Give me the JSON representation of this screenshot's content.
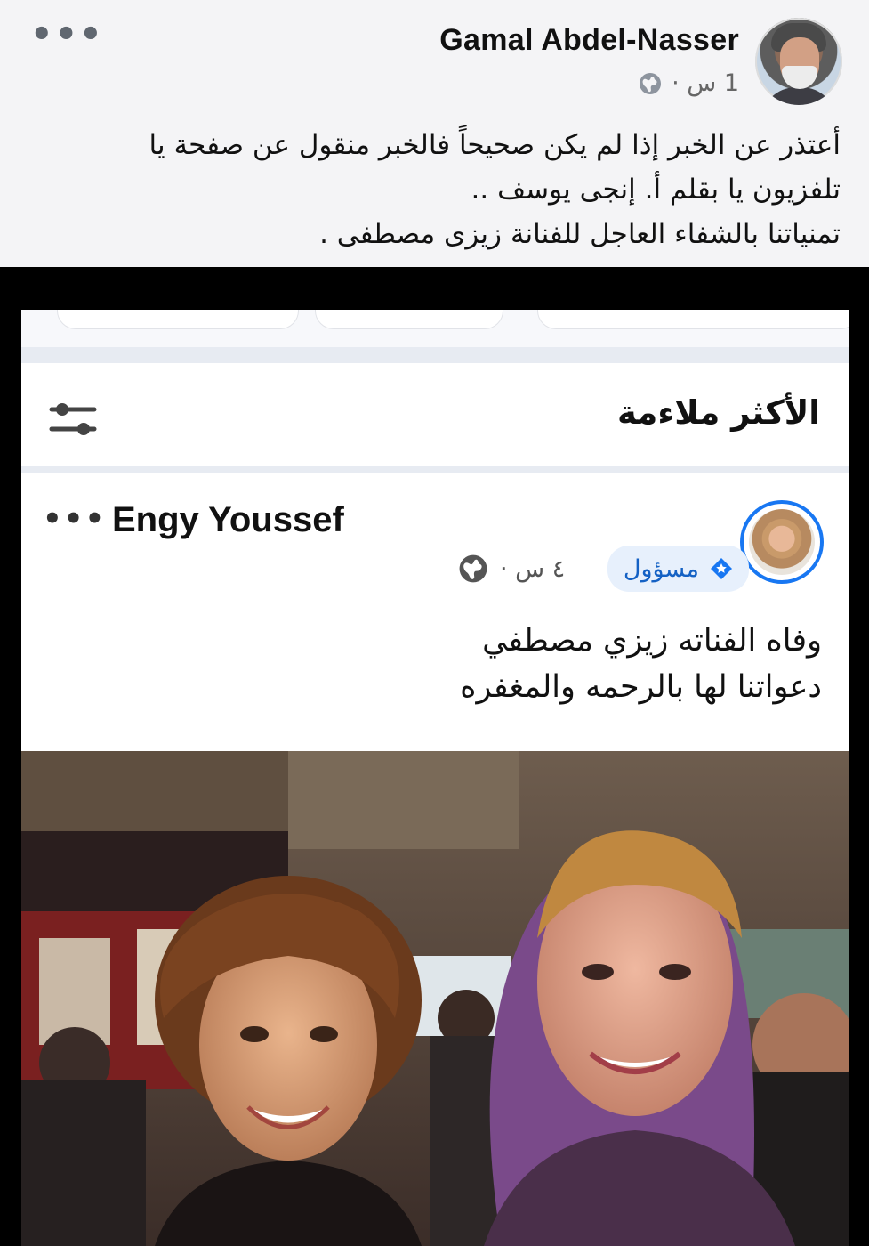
{
  "outer_post": {
    "author": "Gamal Abdel-Nasser",
    "time": "1 س ·",
    "privacy_icon": "globe-icon",
    "more_icon": "more-dots-icon",
    "text_lines": [
      "أعتذر عن الخبر إذا لم يكن صحيحاً فالخبر منقول عن صفحة يا",
      "تلفزيون يا بقلم أ. إنجى يوسف ..",
      "تمنياتنا بالشفاء العاجل للفنانة زيزى مصطفى ."
    ]
  },
  "embedded": {
    "filter_title": "الأكثر ملاءمة",
    "filter_icon": "sliders-icon",
    "post": {
      "author": "Engy Youssef",
      "role_badge": "مسؤول",
      "role_icon": "admin-badge-icon",
      "time": "٤ س ·",
      "privacy_icon": "globe-icon",
      "text_lines": [
        "وفاه الفناته زيزي مصطفي",
        "دعواتنا لها بالرحمه والمغفره"
      ]
    }
  },
  "colors": {
    "accent": "#1877f2",
    "badge_bg": "#e7f0fc",
    "badge_text": "#1461c4",
    "page_bg": "#f4f4f6"
  }
}
